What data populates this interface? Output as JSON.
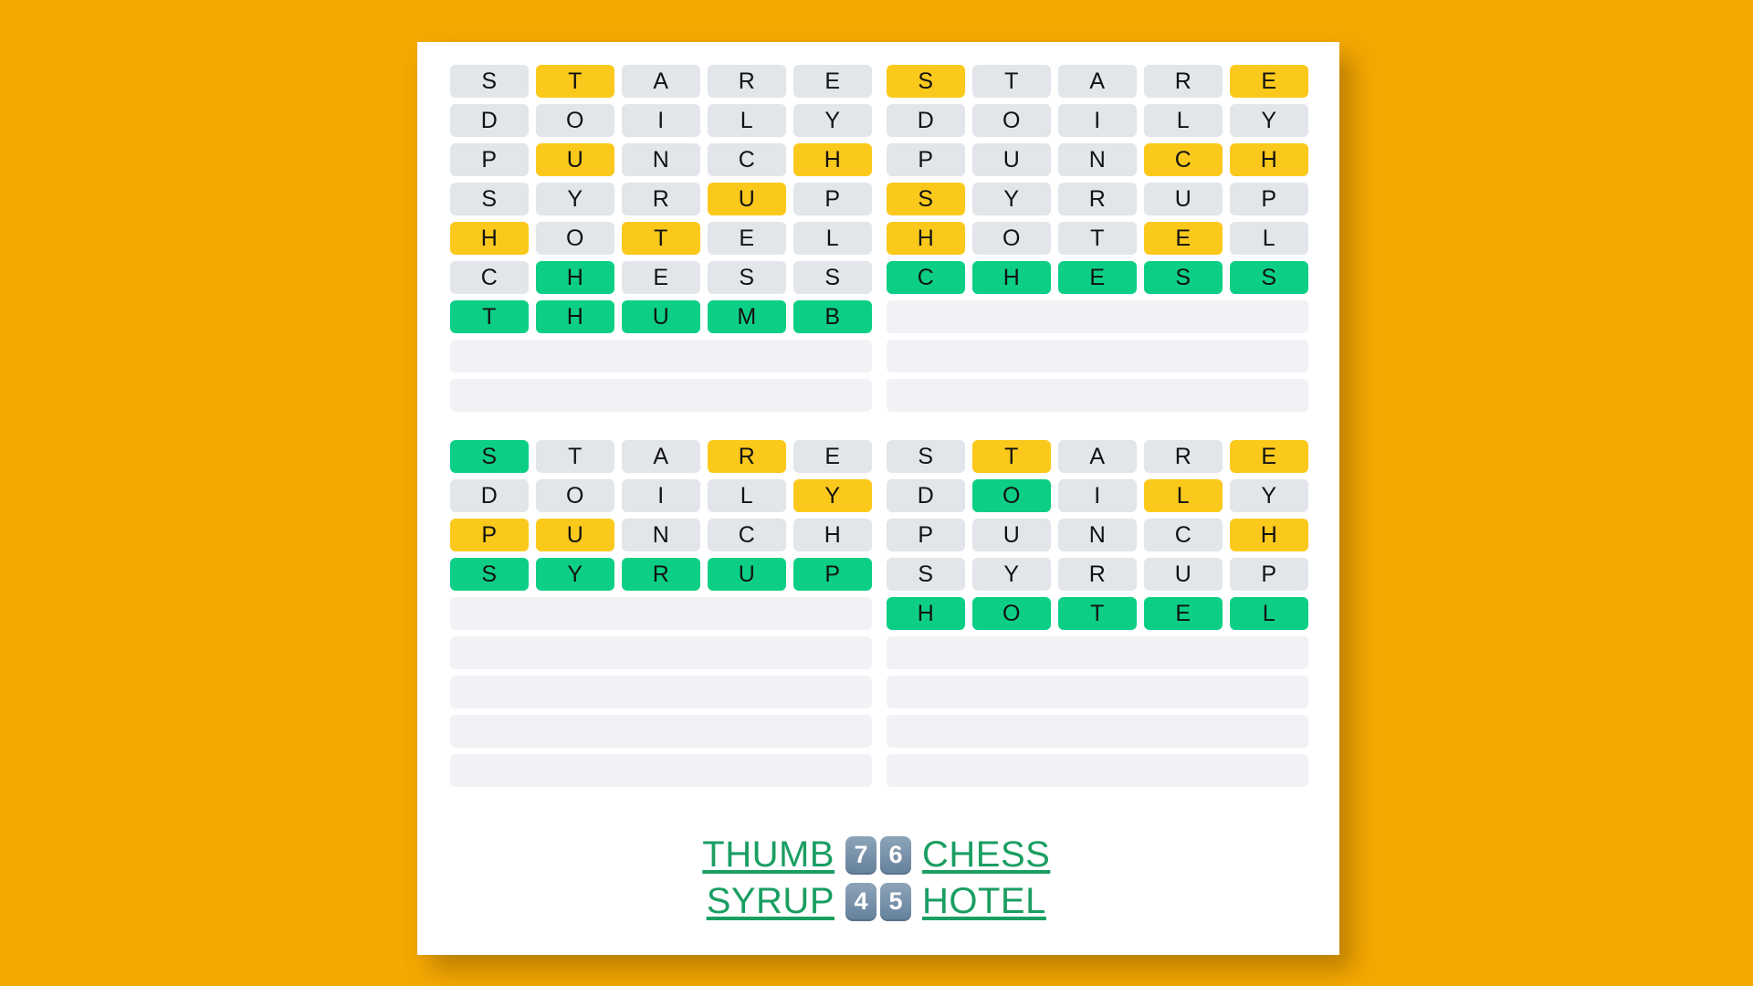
{
  "page": {
    "background_color": "#f5a800",
    "card_color": "#ffffff"
  },
  "colors": {
    "gray": "#e2e5ea",
    "yellow": "#fbc91b",
    "green": "#0ccf85",
    "empty": "#f0f2f6",
    "link": "#1a9e62",
    "badge": "#64809c"
  },
  "boards": [
    {
      "id": "board-top-left",
      "rows": [
        {
          "letters": [
            "S",
            "T",
            "A",
            "R",
            "E"
          ],
          "states": [
            "gray",
            "yellow",
            "gray",
            "gray",
            "gray"
          ]
        },
        {
          "letters": [
            "D",
            "O",
            "I",
            "L",
            "Y"
          ],
          "states": [
            "gray",
            "gray",
            "gray",
            "gray",
            "gray"
          ]
        },
        {
          "letters": [
            "P",
            "U",
            "N",
            "C",
            "H"
          ],
          "states": [
            "gray",
            "yellow",
            "gray",
            "gray",
            "yellow"
          ]
        },
        {
          "letters": [
            "S",
            "Y",
            "R",
            "U",
            "P"
          ],
          "states": [
            "gray",
            "gray",
            "gray",
            "yellow",
            "gray"
          ]
        },
        {
          "letters": [
            "H",
            "O",
            "T",
            "E",
            "L"
          ],
          "states": [
            "yellow",
            "gray",
            "yellow",
            "gray",
            "gray"
          ]
        },
        {
          "letters": [
            "C",
            "H",
            "E",
            "S",
            "S"
          ],
          "states": [
            "gray",
            "green",
            "gray",
            "gray",
            "gray"
          ]
        },
        {
          "letters": [
            "T",
            "H",
            "U",
            "M",
            "B"
          ],
          "states": [
            "green",
            "green",
            "green",
            "green",
            "green"
          ]
        },
        {
          "letters": [],
          "states": []
        },
        {
          "letters": [],
          "states": []
        }
      ]
    },
    {
      "id": "board-top-right",
      "rows": [
        {
          "letters": [
            "S",
            "T",
            "A",
            "R",
            "E"
          ],
          "states": [
            "yellow",
            "gray",
            "gray",
            "gray",
            "yellow"
          ]
        },
        {
          "letters": [
            "D",
            "O",
            "I",
            "L",
            "Y"
          ],
          "states": [
            "gray",
            "gray",
            "gray",
            "gray",
            "gray"
          ]
        },
        {
          "letters": [
            "P",
            "U",
            "N",
            "C",
            "H"
          ],
          "states": [
            "gray",
            "gray",
            "gray",
            "yellow",
            "yellow"
          ]
        },
        {
          "letters": [
            "S",
            "Y",
            "R",
            "U",
            "P"
          ],
          "states": [
            "yellow",
            "gray",
            "gray",
            "gray",
            "gray"
          ]
        },
        {
          "letters": [
            "H",
            "O",
            "T",
            "E",
            "L"
          ],
          "states": [
            "yellow",
            "gray",
            "gray",
            "yellow",
            "gray"
          ]
        },
        {
          "letters": [
            "C",
            "H",
            "E",
            "S",
            "S"
          ],
          "states": [
            "green",
            "green",
            "green",
            "green",
            "green"
          ]
        },
        {
          "letters": [],
          "states": []
        },
        {
          "letters": [],
          "states": []
        },
        {
          "letters": [],
          "states": []
        }
      ]
    },
    {
      "id": "board-bottom-left",
      "rows": [
        {
          "letters": [
            "S",
            "T",
            "A",
            "R",
            "E"
          ],
          "states": [
            "green",
            "gray",
            "gray",
            "yellow",
            "gray"
          ]
        },
        {
          "letters": [
            "D",
            "O",
            "I",
            "L",
            "Y"
          ],
          "states": [
            "gray",
            "gray",
            "gray",
            "gray",
            "yellow"
          ]
        },
        {
          "letters": [
            "P",
            "U",
            "N",
            "C",
            "H"
          ],
          "states": [
            "yellow",
            "yellow",
            "gray",
            "gray",
            "gray"
          ]
        },
        {
          "letters": [
            "S",
            "Y",
            "R",
            "U",
            "P"
          ],
          "states": [
            "green",
            "green",
            "green",
            "green",
            "green"
          ]
        },
        {
          "letters": [],
          "states": []
        },
        {
          "letters": [],
          "states": []
        },
        {
          "letters": [],
          "states": []
        },
        {
          "letters": [],
          "states": []
        },
        {
          "letters": [],
          "states": []
        }
      ]
    },
    {
      "id": "board-bottom-right",
      "rows": [
        {
          "letters": [
            "S",
            "T",
            "A",
            "R",
            "E"
          ],
          "states": [
            "gray",
            "yellow",
            "gray",
            "gray",
            "yellow"
          ]
        },
        {
          "letters": [
            "D",
            "O",
            "I",
            "L",
            "Y"
          ],
          "states": [
            "gray",
            "green",
            "gray",
            "yellow",
            "gray"
          ]
        },
        {
          "letters": [
            "P",
            "U",
            "N",
            "C",
            "H"
          ],
          "states": [
            "gray",
            "gray",
            "gray",
            "gray",
            "yellow"
          ]
        },
        {
          "letters": [
            "S",
            "Y",
            "R",
            "U",
            "P"
          ],
          "states": [
            "gray",
            "gray",
            "gray",
            "gray",
            "gray"
          ]
        },
        {
          "letters": [
            "H",
            "O",
            "T",
            "E",
            "L"
          ],
          "states": [
            "green",
            "green",
            "green",
            "green",
            "green"
          ]
        },
        {
          "letters": [],
          "states": []
        },
        {
          "letters": [],
          "states": []
        },
        {
          "letters": [],
          "states": []
        },
        {
          "letters": [],
          "states": []
        }
      ]
    }
  ],
  "footer": {
    "lines": [
      {
        "left_word": "THUMB",
        "left_score": "7",
        "right_score": "6",
        "right_word": "CHESS"
      },
      {
        "left_word": "SYRUP",
        "left_score": "4",
        "right_score": "5",
        "right_word": "HOTEL"
      }
    ]
  }
}
